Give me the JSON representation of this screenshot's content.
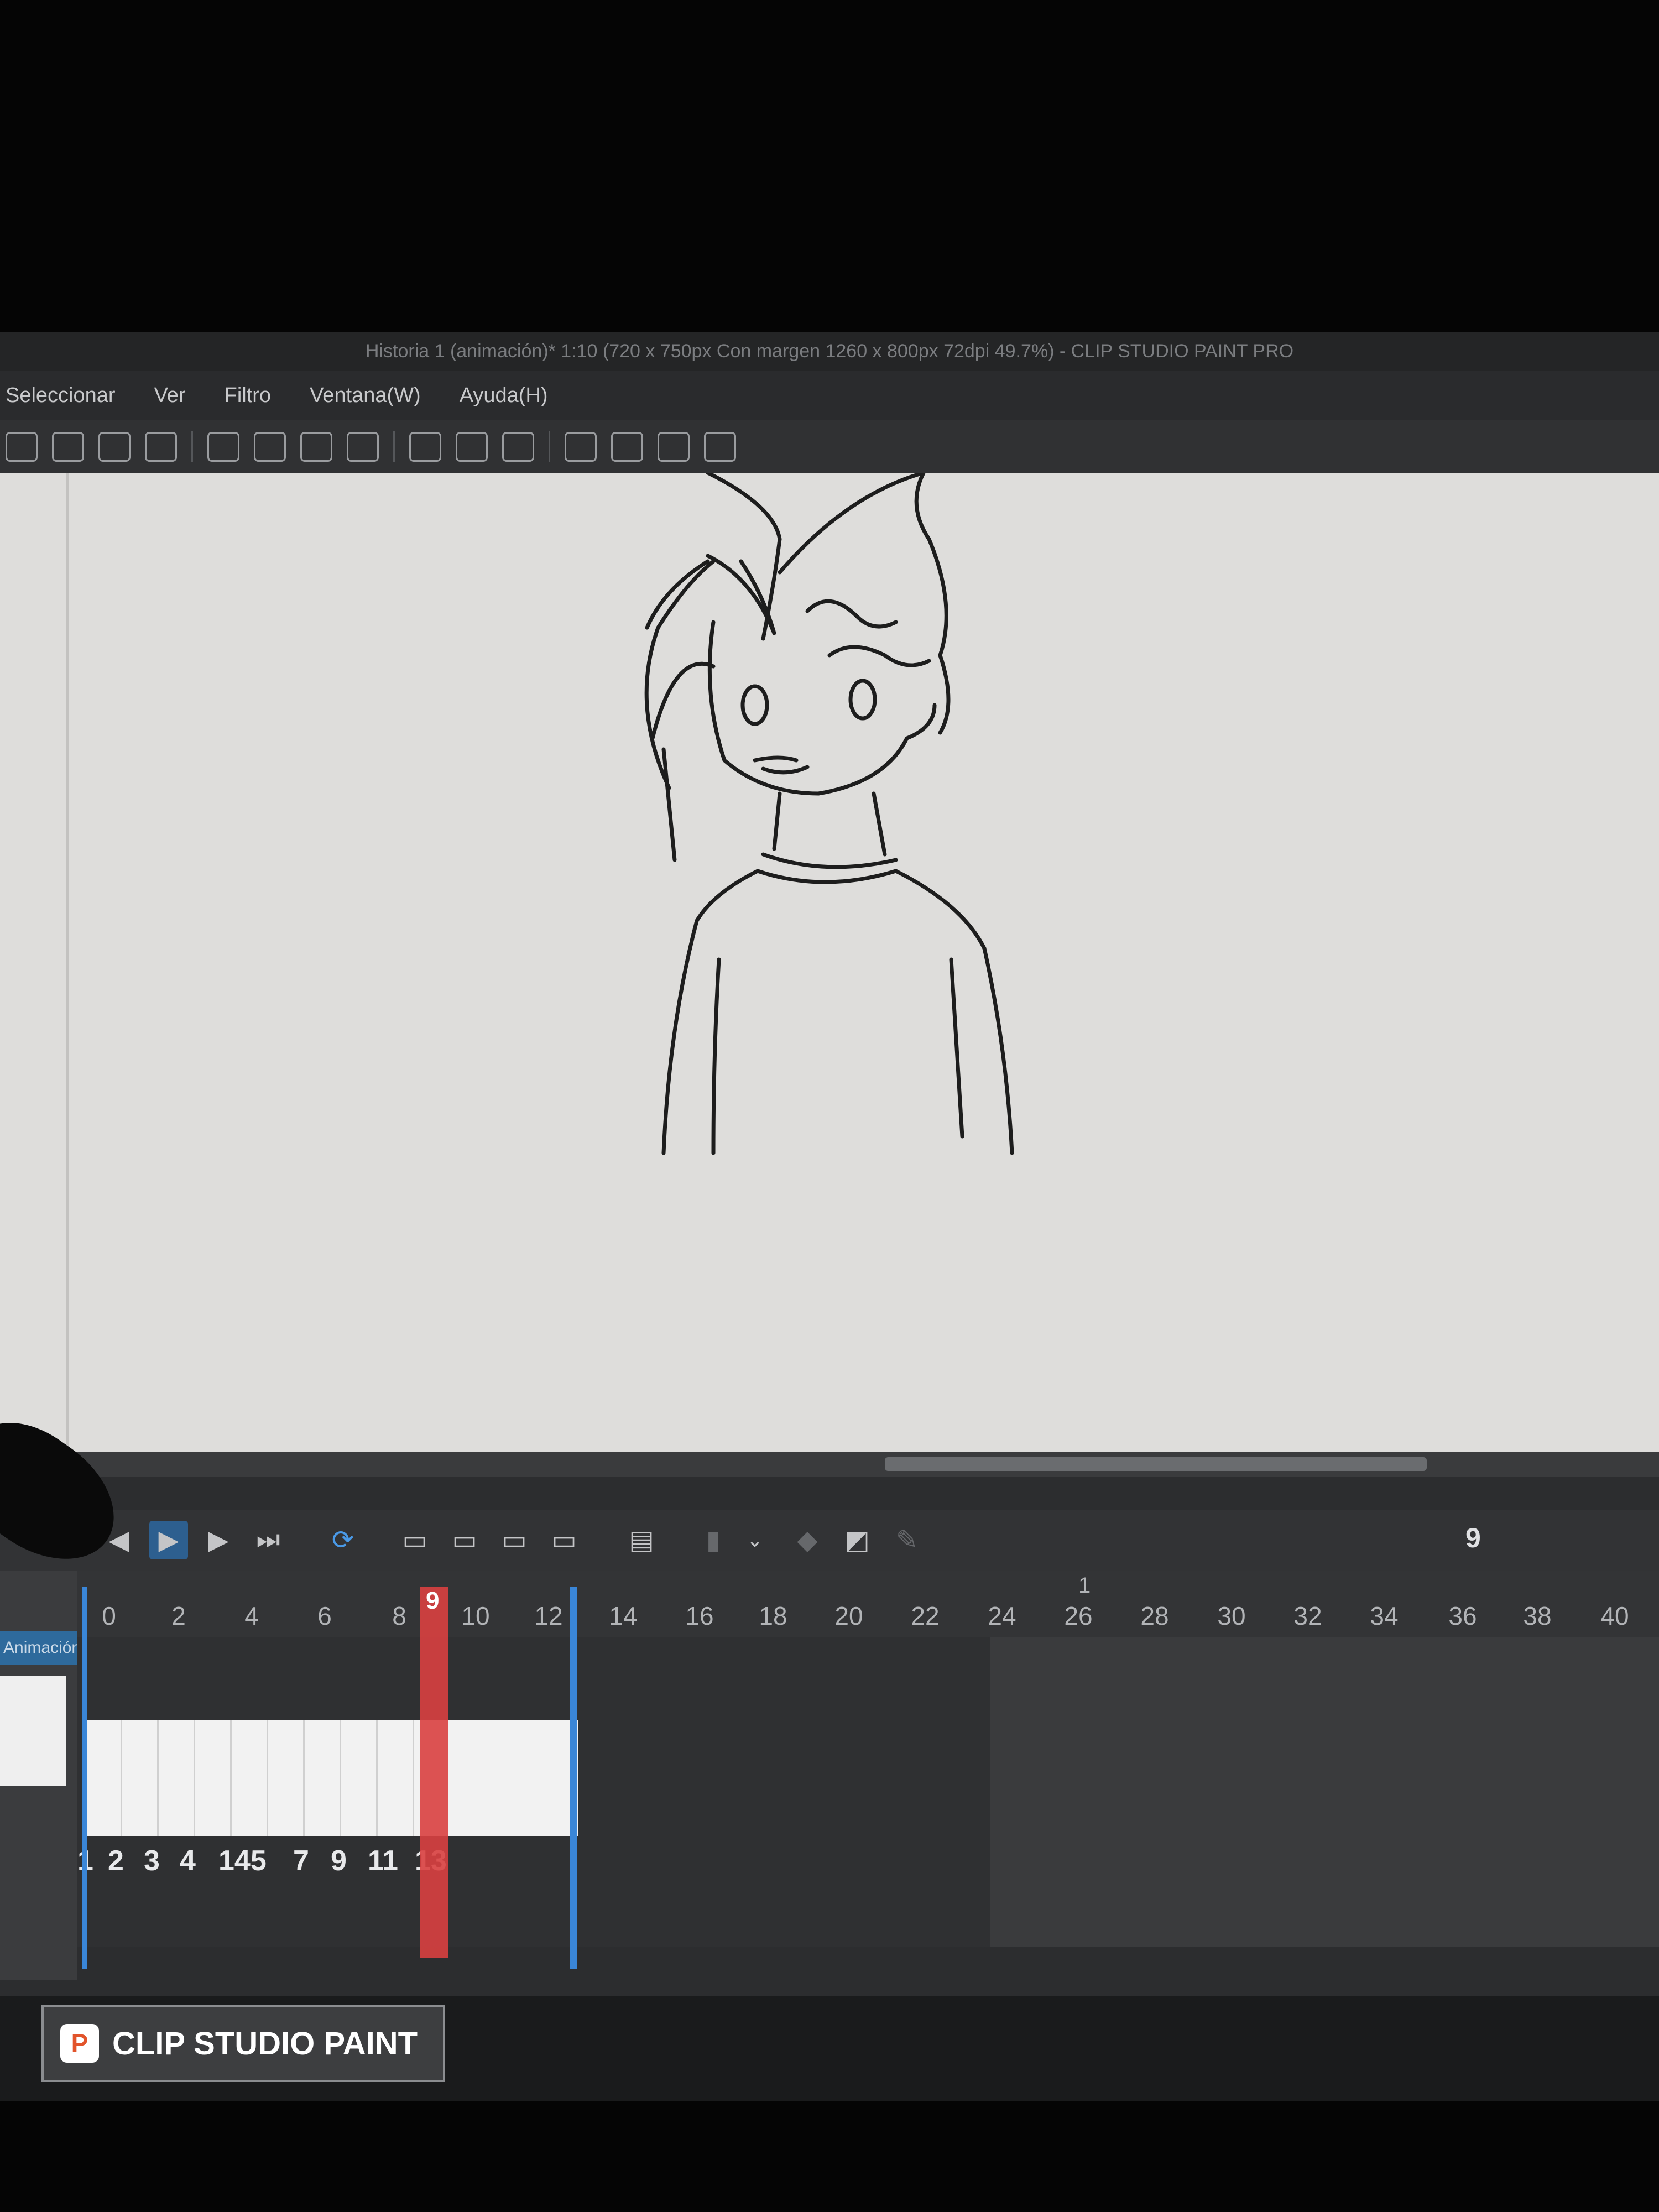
{
  "window": {
    "title": "Historia 1 (animación)* 1:10 (720 x 750px Con margen 1260 x 800px 72dpi 49.7%) - CLIP STUDIO PAINT PRO"
  },
  "menu": {
    "items": [
      "Seleccionar",
      "Ver",
      "Filtro",
      "Ventana(W)",
      "Ayuda(H)"
    ]
  },
  "timeline": {
    "current_frame": "9",
    "ruler_labels": [
      "0",
      "2",
      "4",
      "6",
      "8",
      "10",
      "12",
      "14",
      "16",
      "18",
      "20",
      "22",
      "24",
      "26",
      "28",
      "30",
      "32",
      "34",
      "36",
      "38",
      "40"
    ],
    "second_marker": "1",
    "layer_name": "Animación",
    "cel_labels": [
      "1",
      "2",
      "3",
      "4",
      "145",
      "7",
      "9",
      "11",
      "13"
    ],
    "playhead_label": "9",
    "buttons": [
      "skip-back-icon",
      "play-icon",
      "step-forward-icon",
      "skip-end-icon",
      "loop-icon",
      "new-cel-icon",
      "assign-cel-icon",
      "specify-cel-icon",
      "onion-skin-icon",
      "camera-icon",
      "pencil-icon"
    ]
  },
  "taskbar": {
    "app_label": "CLIP STUDIO PAINT"
  },
  "colors": {
    "playhead": "#d94040",
    "work_area_marker": "#3a86d8",
    "layer_selected": "#2e6a9c",
    "canvas_paper": "#dedddb"
  }
}
